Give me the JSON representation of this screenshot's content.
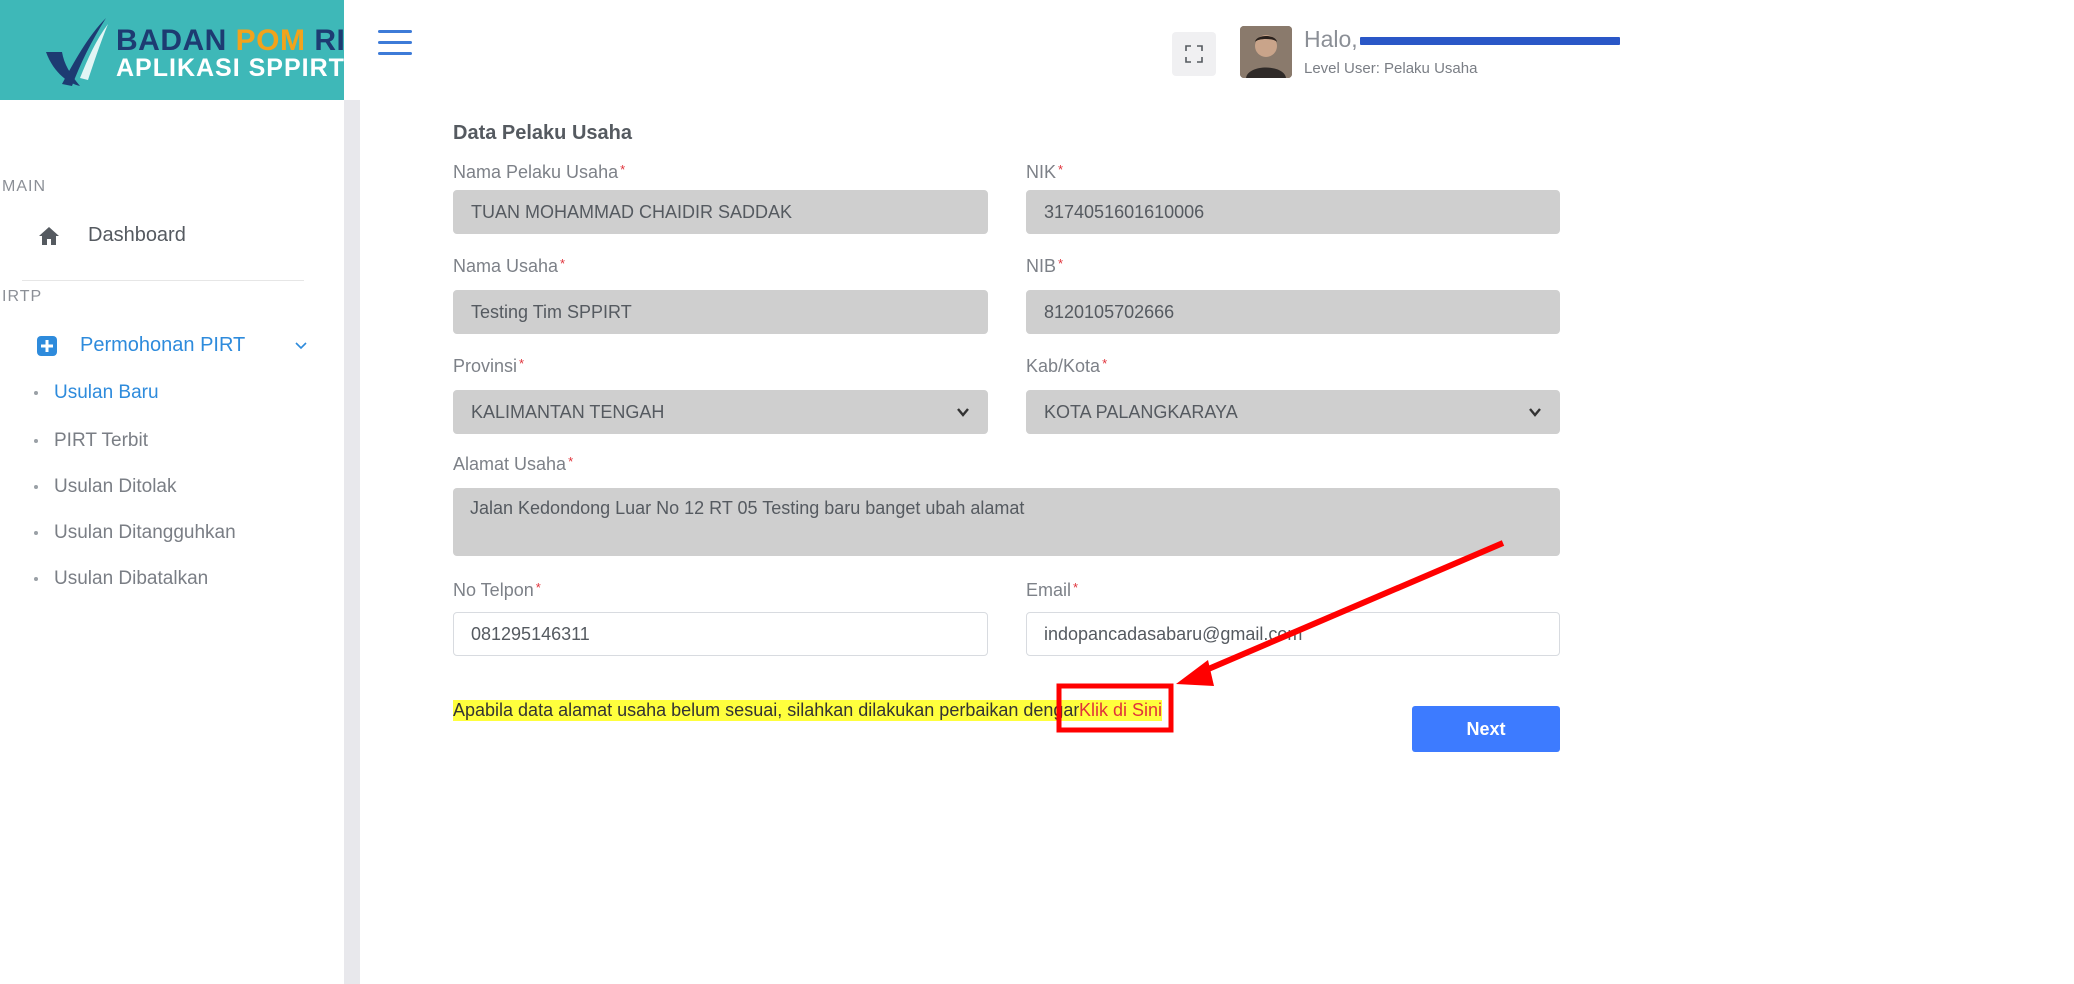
{
  "brand": {
    "line1_a": "BADAN ",
    "line1_b": "POM",
    "line1_c": " RI",
    "line2": "APLIKASI SPPIRT"
  },
  "sidebar": {
    "main_heading": "MAIN",
    "dashboard": "Dashboard",
    "irtp_heading": "IRTP",
    "permohonan": "Permohonan PIRT",
    "sub_items": [
      {
        "label": "Usulan Baru",
        "active": true
      },
      {
        "label": "PIRT Terbit",
        "active": false
      },
      {
        "label": "Usulan Ditolak",
        "active": false
      },
      {
        "label": "Usulan Ditangguhkan",
        "active": false
      },
      {
        "label": "Usulan Dibatalkan",
        "active": false
      }
    ]
  },
  "header": {
    "greeting": "Halo,",
    "level": "Level User: Pelaku Usaha"
  },
  "form": {
    "title": "Data Pelaku Usaha",
    "nama_pelaku": {
      "label": "Nama Pelaku Usaha",
      "value": "TUAN MOHAMMAD CHAIDIR SADDAK"
    },
    "nik": {
      "label": "NIK",
      "value": "3174051601610006"
    },
    "nama_usaha": {
      "label": "Nama Usaha",
      "value": "Testing Tim SPPIRT"
    },
    "nib": {
      "label": "NIB",
      "value": "8120105702666"
    },
    "provinsi": {
      "label": "Provinsi",
      "value": "KALIMANTAN TENGAH"
    },
    "kabkota": {
      "label": "Kab/Kota",
      "value": "KOTA PALANGKARAYA"
    },
    "alamat": {
      "label": "Alamat Usaha",
      "value": "Jalan Kedondong Luar No 12 RT 05 Testing baru banget ubah alamat"
    },
    "telpon": {
      "label": "No Telpon",
      "value": "081295146311"
    },
    "email": {
      "label": "Email",
      "value": "indopancadasabaru@gmail.com"
    },
    "required_mark": "*",
    "notice": "Apabila data alamat usaha belum sesuai, silahkan dilakukan perbaikan dengan",
    "notice_link": "Klik di Sini",
    "next": "Next"
  },
  "colors": {
    "brand_teal": "#3eb8b8",
    "accent_blue": "#3d7bff",
    "annotation_red": "#ff0000",
    "highlight_yellow": "#ffff3d"
  }
}
